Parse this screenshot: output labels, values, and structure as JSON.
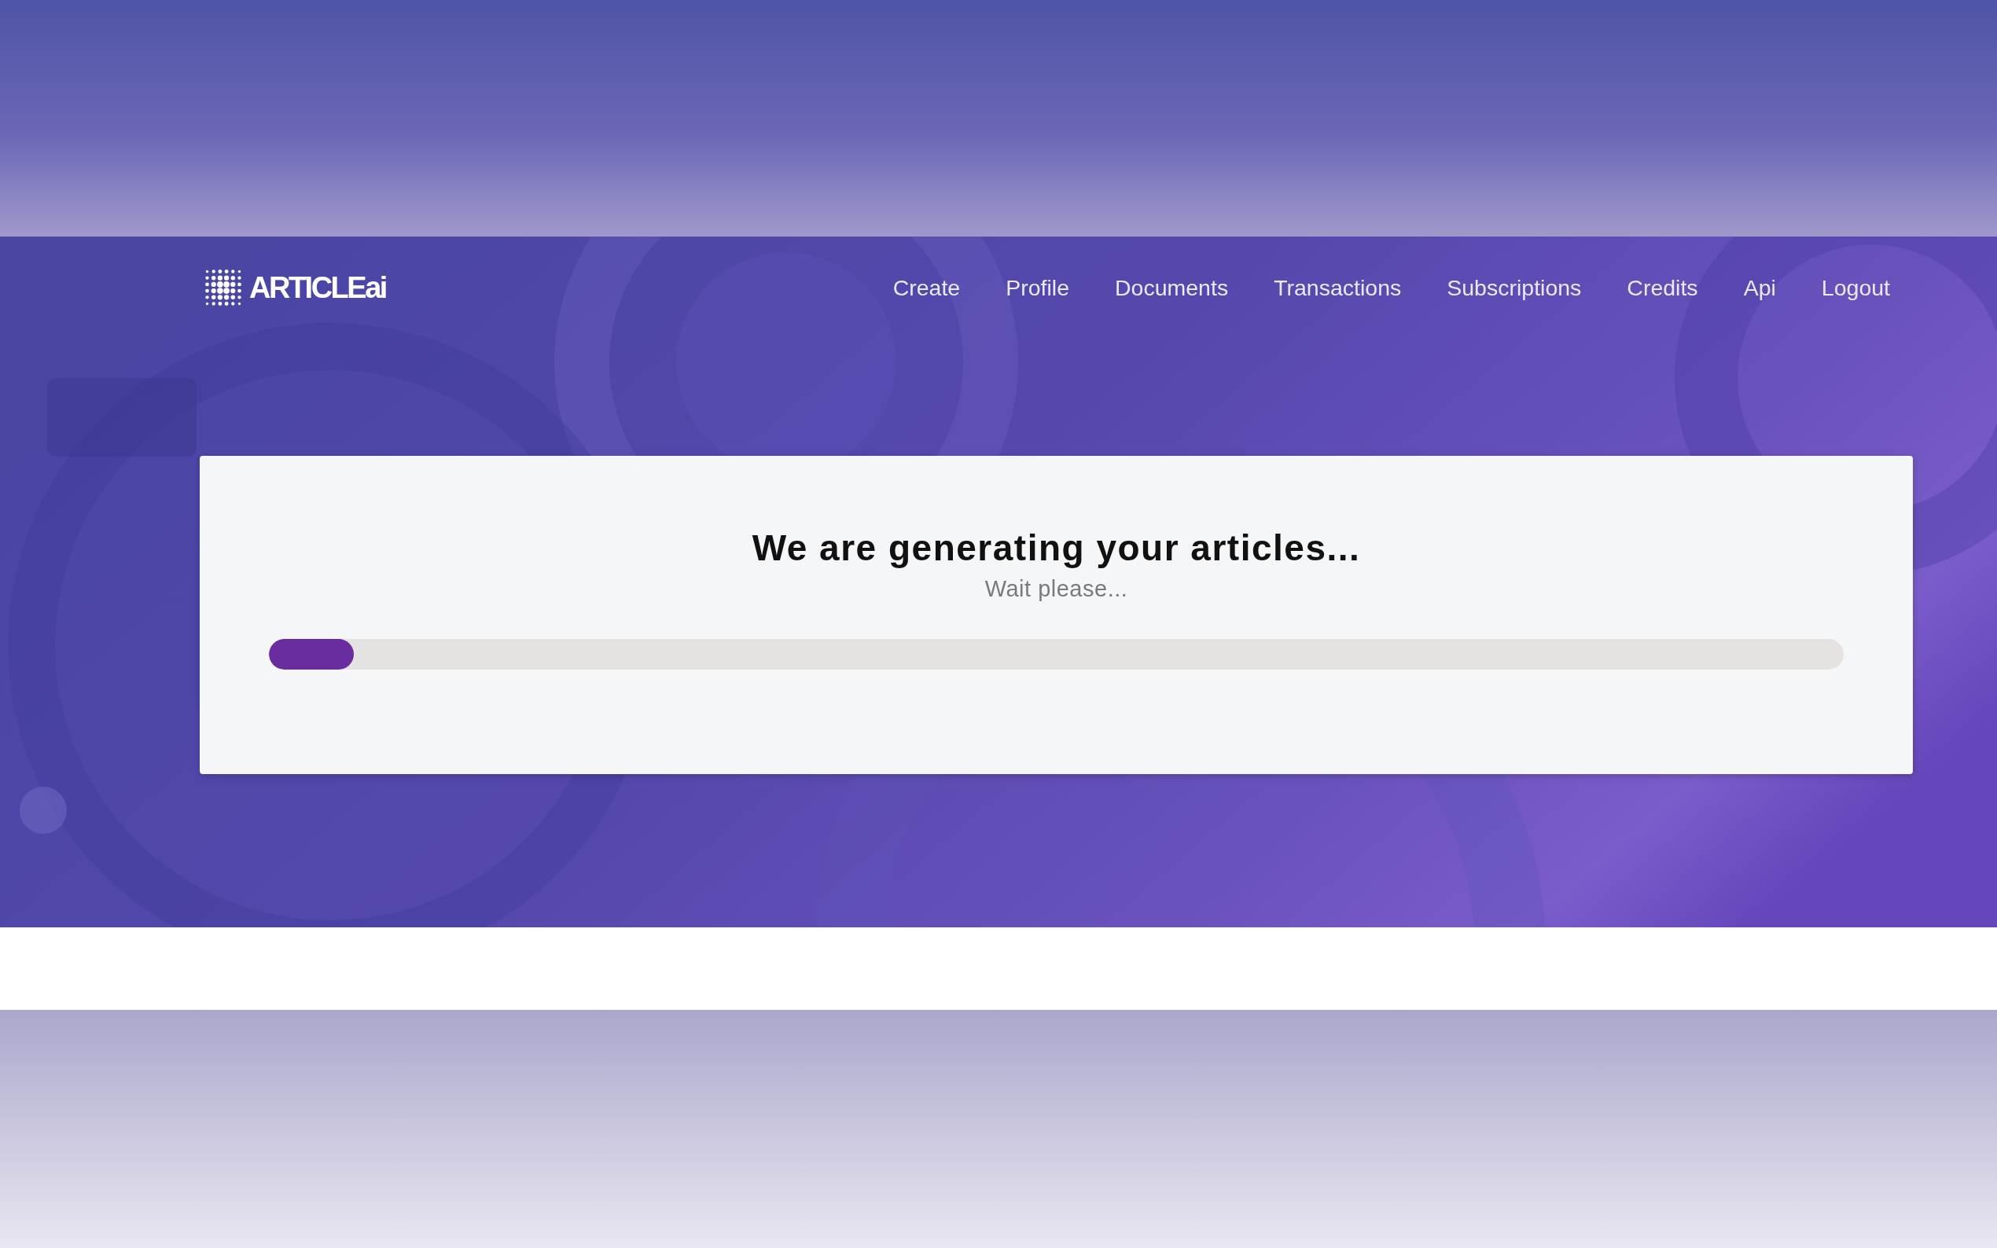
{
  "header": {
    "logo": {
      "text": "ARTICLEai"
    },
    "nav": [
      {
        "label": "Create"
      },
      {
        "label": "Profile"
      },
      {
        "label": "Documents"
      },
      {
        "label": "Transactions"
      },
      {
        "label": "Subscriptions"
      },
      {
        "label": "Credits"
      },
      {
        "label": "Api"
      },
      {
        "label": "Logout"
      }
    ]
  },
  "card": {
    "title": "We are generating your articles...",
    "subtitle": "Wait please...",
    "progress": {
      "level": 0.054
    }
  }
}
